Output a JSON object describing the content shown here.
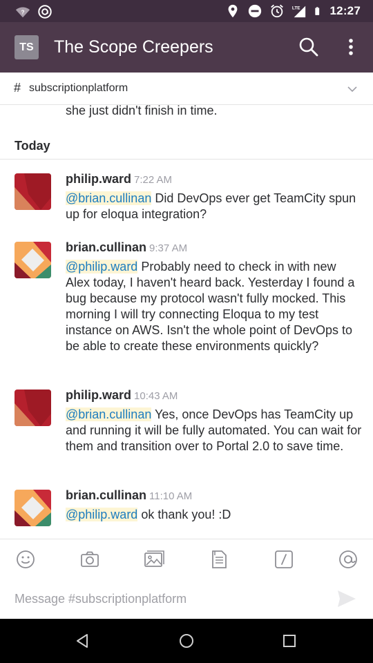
{
  "status_bar": {
    "time": "12:27",
    "icons": [
      "wifi-question-icon",
      "at-sign-notification-icon",
      "location-icon",
      "do-not-disturb-icon",
      "alarm-icon",
      "lte-signal-icon",
      "battery-icon"
    ],
    "lte_label": "LTE",
    "wifi_label": "?"
  },
  "app_bar": {
    "team_initials": "TS",
    "title": "The Scope Creepers",
    "icons": [
      "search-icon",
      "more-vert-icon"
    ]
  },
  "channel": {
    "hash": "#",
    "name": "subscriptionplatform",
    "icon": "chevron-down-icon"
  },
  "messages": {
    "previous_text": "she just didn't finish in time.",
    "day_label": "Today",
    "items": [
      {
        "user": "philip.ward",
        "time": "7:22 AM",
        "mention": "@brian.cullinan",
        "text": " Did DevOps ever get TeamCity spun up for eloqua integration?",
        "avatar": "avatar-red"
      },
      {
        "user": "brian.cullinan",
        "time": "9:37 AM",
        "mention": "@philip.ward",
        "text": " Probably need to check in with new Alex today, I haven't heard back. Yesterday I found a bug because my protocol wasn't fully mocked. This morning I will try connecting Eloqua to my test instance on AWS. Isn't the whole point of DevOps to be able to create these environments quickly?",
        "avatar": "avatar-multicolor"
      },
      {
        "user": "philip.ward",
        "time": "10:43 AM",
        "mention": "@brian.cullinan",
        "text": " Yes, once DevOps has TeamCity up and running it will be fully automated. You can wait for them and transition over to Portal 2.0 to save time.",
        "avatar": "avatar-red"
      },
      {
        "user": "brian.cullinan",
        "time": "11:10 AM",
        "mention": "@philip.ward",
        "text": " ok thank you! :D",
        "avatar": "avatar-multicolor"
      }
    ]
  },
  "toolbar": {
    "icons": [
      "emoji-icon",
      "camera-icon",
      "gallery-icon",
      "file-upload-icon",
      "slash-command-icon",
      "mention-icon"
    ]
  },
  "composer": {
    "placeholder": "Message #subscriptionplatform",
    "send_icon": "send-icon"
  },
  "nav_bar": {
    "icons": [
      "back-icon",
      "home-icon",
      "recents-icon"
    ]
  },
  "colors": {
    "status_bar": "#3e2d3f",
    "app_bar": "#4d394b",
    "mention_text": "#1d7dbf",
    "mention_bg": "#fdf5d4",
    "timestamp": "#9e9ea6"
  }
}
